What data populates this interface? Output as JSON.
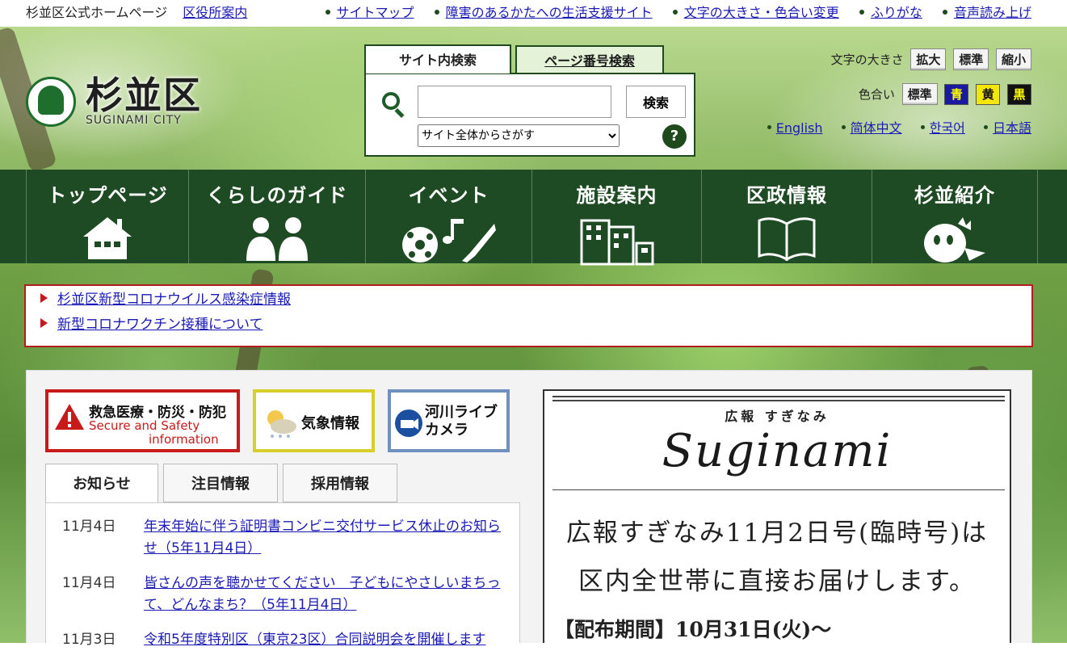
{
  "topbar": {
    "site_name": "杉並区公式ホームページ",
    "office_link": "区役所案内",
    "links": [
      "サイトマップ",
      "障害のあるかたへの生活支援サイト",
      "文字の大きさ・色合い変更",
      "ふりがな",
      "音声読み上げ"
    ]
  },
  "logo": {
    "jp": "杉並区",
    "en": "SUGINAMI CITY"
  },
  "search": {
    "tab_site": "サイト内検索",
    "tab_page": "ページ番号検索",
    "input_value": "",
    "button": "検索",
    "scope_selected": "サイト全体からさがす",
    "help": "?"
  },
  "font_size": {
    "label": "文字の大きさ",
    "buttons": [
      "拡大",
      "標準",
      "縮小"
    ]
  },
  "color_scheme": {
    "label": "色合い",
    "buttons": [
      {
        "label": "標準",
        "bg": "#f4f4f4",
        "fg": "#222222"
      },
      {
        "label": "青",
        "bg": "#1a1aa0",
        "fg": "#ffff00"
      },
      {
        "label": "黄",
        "bg": "#f5e60a",
        "fg": "#111111"
      },
      {
        "label": "黒",
        "bg": "#111111",
        "fg": "#ffff00"
      }
    ]
  },
  "languages": [
    "English",
    "简体中文",
    "한국어",
    "日本語"
  ],
  "nav": [
    {
      "label": "トップページ",
      "icon": "house-icon"
    },
    {
      "label": "くらしのガイド",
      "icon": "people-icon"
    },
    {
      "label": "イベント",
      "icon": "event-icon"
    },
    {
      "label": "施設案内",
      "icon": "building-icon"
    },
    {
      "label": "区政情報",
      "icon": "book-icon"
    },
    {
      "label": "杉並紹介",
      "icon": "mascot-icon"
    }
  ],
  "notices": [
    "杉並区新型コロナウイルス感染症情報",
    "新型コロナワクチン接種について"
  ],
  "quick": {
    "emergency": {
      "jp": "救急医療・防災・防犯",
      "en1": "Secure and Safety",
      "en2": "information"
    },
    "weather": "気象情報",
    "river_1": "河川ライブ",
    "river_2": "カメラ"
  },
  "tabs": [
    "お知らせ",
    "注目情報",
    "採用情報"
  ],
  "news": [
    {
      "date": "11月4日",
      "title": "年末年始に伴う証明書コンビニ交付サービス休止のお知らせ（5年11月4日）"
    },
    {
      "date": "11月4日",
      "title": "皆さんの声を聴かせてください　子どもにやさしいまちって、どんなまち？（5年11月4日）"
    },
    {
      "date": "11月3日",
      "title": "令和5年度特別区（東京23区）合同説明会を開催します"
    }
  ],
  "koho": {
    "small": "広報 すぎなみ",
    "script": "Suginami",
    "line1": "広報すぎなみ11月2日号(臨時号)は",
    "line2": "区内全世帯に直接お届けします。",
    "line3": "【配布期間】10月31日(火)〜"
  },
  "colors": {
    "nav_green": "#1e4a24",
    "notice_red": "#b21e1e",
    "link_blue": "#1a1ab5"
  }
}
